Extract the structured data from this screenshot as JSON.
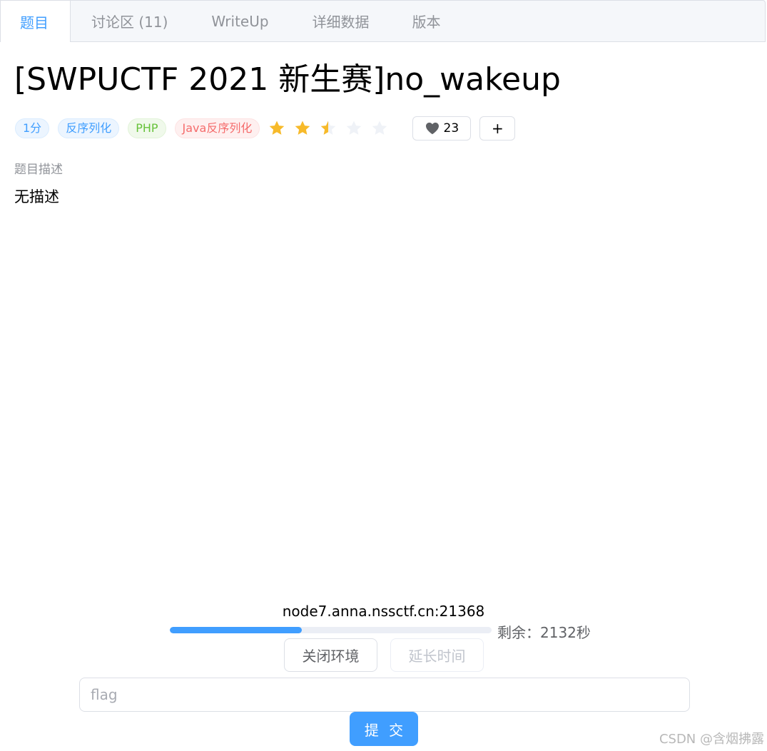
{
  "tabs": [
    {
      "label": "题目",
      "active": true
    },
    {
      "label": "讨论区 (11)",
      "active": false
    },
    {
      "label": "WriteUp",
      "active": false
    },
    {
      "label": "详细数据",
      "active": false
    },
    {
      "label": "版本",
      "active": false
    }
  ],
  "challenge": {
    "title": "[SWPUCTF 2021 新生赛]no_wakeup",
    "tags": {
      "score": "1分",
      "category1": "反序列化",
      "category2": "PHP",
      "category3": "Java反序列化"
    },
    "rating": {
      "value": 2.5,
      "max": 5
    },
    "likes": "23",
    "add_label": "+",
    "description_label": "题目描述",
    "description": "无描述"
  },
  "environment": {
    "address": "node7.anna.nssctf.cn:21368",
    "progress_fraction": 0.41,
    "remaining_text": "剩余：2132秒",
    "close_label": "关闭环境",
    "extend_label": "延长时间"
  },
  "submit": {
    "placeholder": "flag",
    "value": "",
    "button_label": "提 交"
  },
  "watermark": "CSDN @含烟拂露",
  "colors": {
    "accent": "#409eff",
    "star_filled": "#f7ba2a",
    "star_empty": "#eff2f7"
  },
  "icons": {
    "star": "star-icon",
    "like": "heart-icon"
  }
}
